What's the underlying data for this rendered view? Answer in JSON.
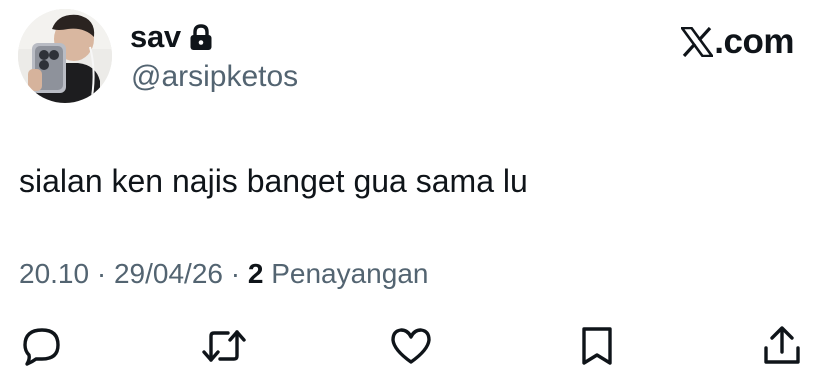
{
  "author": {
    "display_name": "sav",
    "handle": "@arsipketos",
    "protected_icon": "lock-icon",
    "avatar": "profile-photo"
  },
  "brand": {
    "logo_icon": "x-logo-icon",
    "suffix": ".com"
  },
  "tweet": {
    "text": "sialan ken najis banget gua sama lu"
  },
  "meta": {
    "time": "20.10",
    "separator": "·",
    "date": "29/04/26",
    "views_count": "2",
    "views_label": "Penayangan"
  },
  "actions": [
    {
      "name": "reply",
      "icon": "speech-bubble-icon"
    },
    {
      "name": "repost",
      "icon": "repost-arrows-icon"
    },
    {
      "name": "like",
      "icon": "heart-icon"
    },
    {
      "name": "bookmark",
      "icon": "bookmark-icon"
    },
    {
      "name": "share",
      "icon": "share-upload-icon"
    }
  ],
  "colors": {
    "primary_text": "#0f1419",
    "secondary_text": "#536471",
    "background": "#ffffff"
  }
}
